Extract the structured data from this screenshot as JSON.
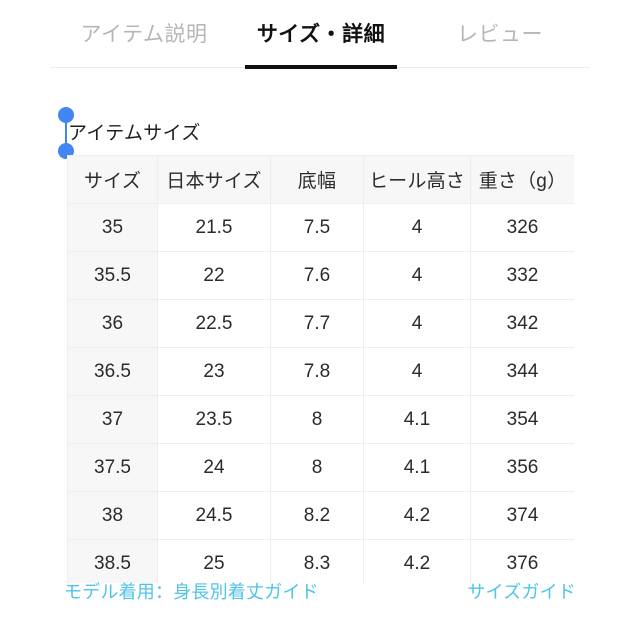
{
  "tabs": [
    {
      "label": "アイテム説明",
      "active": false
    },
    {
      "label": "サイズ・詳細",
      "active": true
    },
    {
      "label": "レビュー",
      "active": false
    }
  ],
  "section": {
    "title": "アイテムサイズ"
  },
  "table": {
    "headers": [
      "サイズ",
      "日本サイズ",
      "底幅",
      "ヒール高さ",
      "重さ（g）"
    ],
    "rows": [
      [
        "35",
        "21.5",
        "7.5",
        "4",
        "326"
      ],
      [
        "35.5",
        "22",
        "7.6",
        "4",
        "332"
      ],
      [
        "36",
        "22.5",
        "7.7",
        "4",
        "342"
      ],
      [
        "36.5",
        "23",
        "7.8",
        "4",
        "344"
      ],
      [
        "37",
        "23.5",
        "8",
        "4.1",
        "354"
      ],
      [
        "37.5",
        "24",
        "8",
        "4.1",
        "356"
      ],
      [
        "38",
        "24.5",
        "8.2",
        "4.2",
        "374"
      ],
      [
        "38.5",
        "25",
        "8.3",
        "4.2",
        "376"
      ]
    ]
  },
  "footer": {
    "left_link": "モデル着用：身長別着丈ガイド",
    "right_link": "サイズガイド"
  },
  "colors": {
    "accent_link": "#4fc3e8",
    "selection_handle": "#4285f4",
    "active_tab": "#111111",
    "inactive_tab": "#b6b6b6",
    "header_cell_bg": "#f7f7f7",
    "scrollbar_thumb": "#cfcfcf"
  }
}
